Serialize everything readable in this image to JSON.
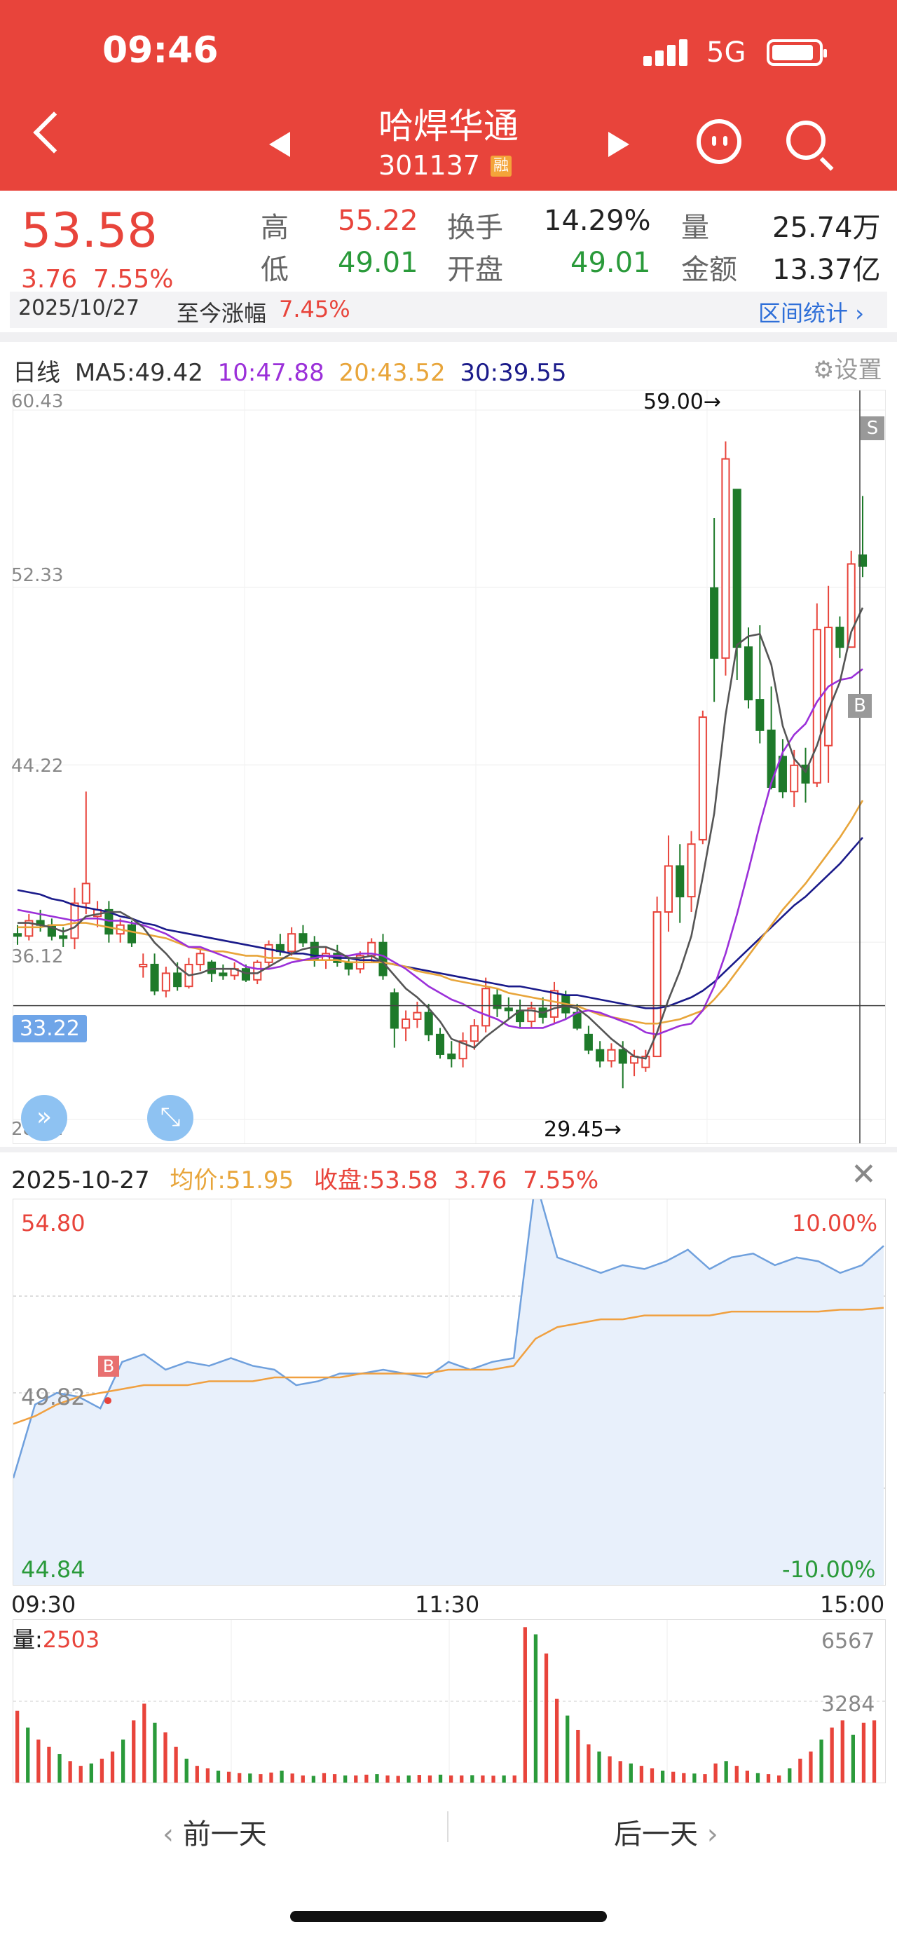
{
  "status_bar": {
    "time": "09:46",
    "network": "5G"
  },
  "header": {
    "title": "哈焊华通",
    "code": "301137",
    "badge": "融"
  },
  "quote": {
    "price": "53.58",
    "change": "3.76",
    "change_pct": "7.55%",
    "high_label": "高",
    "high": "55.22",
    "low_label": "低",
    "low": "49.01",
    "turnover_label": "换手",
    "turnover": "14.29%",
    "open_label": "开盘",
    "open": "49.01",
    "volume_label": "量",
    "volume": "25.74万",
    "amount_label": "金额",
    "amount": "13.37亿",
    "date": "2025/10/27",
    "since_label": "至今涨幅",
    "since_value": "7.45%",
    "range_stats": "区间统计"
  },
  "kline": {
    "period": "日线",
    "ma5": "MA5:49.42",
    "ma10": "10:47.88",
    "ma20": "20:43.52",
    "ma30": "30:39.55",
    "settings": "设置",
    "y_labels": [
      "60.43",
      "52.33",
      "44.22",
      "36.12",
      "28.02"
    ],
    "crosshair_price": "33.22",
    "high_mark": "59.00→",
    "low_mark": "29.45→",
    "s_mark": "S",
    "b_mark": "B",
    "colors": {
      "up": "#e8443b",
      "down": "#1e7a2a",
      "ma5": "#555555",
      "ma10": "#9b30d9",
      "ma20": "#e8a53a",
      "ma30": "#1a1a8a"
    }
  },
  "intraday": {
    "date": "2025-10-27",
    "avg": "均价:51.95",
    "close": "收盘:53.58",
    "chg": "3.76",
    "pct": "7.55%",
    "top_price": "54.80",
    "mid_price": "49.82",
    "bottom_price": "44.84",
    "top_pct": "10.00%",
    "bottom_pct": "-10.00%",
    "b_mark": "B",
    "times": [
      "09:30",
      "11:30",
      "15:00"
    ],
    "vol_label": "量:",
    "vol_value": "2503",
    "vol_max": "6567",
    "vol_mid": "3284"
  },
  "nav": {
    "prev": "前一天",
    "next": "后一天"
  },
  "chart_data": [
    {
      "type": "candlestick",
      "title": "",
      "ylim": [
        28.02,
        60.43
      ],
      "candles": [
        [
          36.5,
          36.9,
          36.0,
          36.4
        ],
        [
          36.4,
          37.4,
          36.2,
          37.1
        ],
        [
          37.1,
          37.6,
          36.6,
          36.9
        ],
        [
          36.9,
          37.2,
          36.2,
          36.4
        ],
        [
          36.4,
          36.8,
          35.9,
          36.3
        ],
        [
          36.3,
          38.6,
          35.8,
          37.9
        ],
        [
          37.9,
          43.0,
          37.4,
          38.8
        ],
        [
          37.3,
          38.0,
          36.8,
          37.6
        ],
        [
          37.6,
          38.0,
          36.1,
          36.5
        ],
        [
          36.5,
          37.2,
          36.1,
          36.9
        ],
        [
          36.9,
          37.1,
          35.9,
          36.1
        ],
        [
          35.0,
          35.6,
          34.5,
          35.1
        ],
        [
          35.1,
          35.6,
          33.7,
          33.9
        ],
        [
          33.9,
          35.0,
          33.6,
          34.7
        ],
        [
          34.7,
          35.2,
          33.9,
          34.1
        ],
        [
          34.1,
          35.4,
          34.0,
          35.1
        ],
        [
          35.1,
          35.8,
          34.8,
          35.6
        ],
        [
          35.2,
          35.3,
          34.3,
          34.7
        ],
        [
          34.7,
          35.1,
          34.4,
          34.6
        ],
        [
          34.6,
          35.2,
          34.4,
          34.9
        ],
        [
          34.9,
          35.1,
          34.3,
          34.4
        ],
        [
          34.4,
          35.3,
          34.2,
          35.2
        ],
        [
          35.2,
          36.2,
          34.9,
          36.0
        ],
        [
          36.0,
          36.5,
          35.5,
          35.7
        ],
        [
          35.7,
          36.8,
          35.5,
          36.5
        ],
        [
          36.5,
          36.9,
          35.9,
          36.1
        ],
        [
          36.1,
          36.4,
          35.0,
          35.3
        ],
        [
          35.3,
          35.9,
          34.9,
          35.6
        ],
        [
          35.6,
          36.0,
          35.0,
          35.2
        ],
        [
          35.2,
          35.4,
          34.6,
          34.9
        ],
        [
          34.9,
          35.7,
          34.7,
          35.5
        ],
        [
          35.5,
          36.3,
          35.2,
          36.1
        ],
        [
          36.1,
          36.5,
          34.4,
          34.6
        ],
        [
          33.8,
          34.0,
          31.3,
          32.2
        ],
        [
          32.2,
          33.0,
          31.6,
          32.6
        ],
        [
          32.6,
          33.4,
          32.2,
          32.9
        ],
        [
          32.9,
          33.3,
          31.6,
          31.9
        ],
        [
          31.9,
          32.2,
          30.8,
          31.0
        ],
        [
          31.0,
          31.6,
          30.4,
          30.8
        ],
        [
          30.8,
          32.0,
          30.4,
          31.6
        ],
        [
          31.6,
          32.6,
          31.2,
          32.3
        ],
        [
          32.3,
          34.5,
          32.0,
          34.0
        ],
        [
          33.7,
          34.0,
          32.7,
          33.1
        ],
        [
          33.1,
          33.6,
          32.6,
          33.0
        ],
        [
          33.0,
          33.5,
          32.2,
          32.5
        ],
        [
          32.5,
          33.4,
          32.2,
          33.1
        ],
        [
          33.1,
          33.6,
          32.4,
          32.7
        ],
        [
          32.7,
          34.3,
          32.4,
          33.9
        ],
        [
          33.7,
          33.9,
          32.6,
          32.9
        ],
        [
          32.9,
          33.3,
          32.1,
          32.2
        ],
        [
          31.9,
          32.3,
          31.0,
          31.2
        ],
        [
          31.2,
          31.6,
          30.4,
          30.7
        ],
        [
          30.7,
          31.5,
          30.4,
          31.2
        ],
        [
          31.2,
          31.6,
          29.45,
          30.6
        ],
        [
          30.6,
          31.2,
          30.0,
          30.9
        ],
        [
          30.4,
          31.2,
          30.2,
          30.9
        ],
        [
          30.9,
          38.2,
          30.9,
          37.5
        ],
        [
          37.5,
          41.0,
          36.6,
          39.6
        ],
        [
          39.6,
          40.6,
          37.0,
          38.2
        ],
        [
          38.2,
          41.2,
          37.5,
          40.6
        ],
        [
          40.8,
          46.7,
          40.6,
          46.4
        ],
        [
          52.3,
          55.5,
          47.1,
          49.1
        ],
        [
          49.1,
          59.0,
          48.3,
          58.2
        ],
        [
          56.8,
          56.8,
          48.1,
          49.6
        ],
        [
          49.6,
          50.5,
          46.8,
          47.2
        ],
        [
          47.2,
          50.6,
          45.2,
          45.8
        ],
        [
          45.8,
          47.8,
          43.1,
          43.2
        ],
        [
          44.6,
          45.4,
          42.7,
          43.0
        ],
        [
          43.0,
          44.9,
          42.3,
          44.2
        ],
        [
          44.2,
          45.0,
          42.5,
          43.4
        ],
        [
          43.4,
          51.6,
          43.2,
          50.4
        ],
        [
          45.1,
          52.4,
          43.4,
          50.5
        ],
        [
          50.5,
          51.0,
          49.1,
          49.6
        ],
        [
          49.6,
          54.0,
          49.6,
          53.4
        ],
        [
          53.8,
          56.5,
          52.8,
          53.3
        ]
      ],
      "ma5": [
        37.0,
        37.0,
        36.9,
        36.8,
        36.6,
        36.8,
        37.3,
        37.4,
        37.5,
        37.5,
        37.2,
        36.8,
        36.1,
        35.6,
        35.0,
        34.6,
        34.7,
        34.9,
        34.9,
        34.9,
        34.7,
        34.7,
        35.0,
        35.3,
        35.6,
        35.8,
        35.9,
        35.9,
        35.7,
        35.4,
        35.4,
        35.5,
        35.2,
        34.6,
        34.0,
        33.6,
        33.1,
        32.5,
        31.7,
        31.5,
        31.3,
        31.8,
        32.2,
        32.6,
        33.0,
        33.0,
        32.9,
        33.1,
        33.2,
        33.1,
        32.7,
        32.2,
        31.7,
        31.3,
        30.9,
        30.8,
        32.0,
        33.5,
        34.8,
        36.4,
        39.1,
        42.0,
        46.5,
        49.7,
        50.1,
        50.2,
        48.8,
        46.0,
        44.5,
        43.9,
        45.1,
        46.7,
        48.0,
        50.3,
        51.4
      ],
      "ma10": [
        37.6,
        37.5,
        37.4,
        37.3,
        37.2,
        37.1,
        37.2,
        37.2,
        37.1,
        37.1,
        37.0,
        36.9,
        36.7,
        36.5,
        36.2,
        35.9,
        35.9,
        35.7,
        35.5,
        35.3,
        35.0,
        34.9,
        34.9,
        35.0,
        35.2,
        35.3,
        35.4,
        35.5,
        35.5,
        35.5,
        35.6,
        35.6,
        35.5,
        35.2,
        34.9,
        34.5,
        34.1,
        33.8,
        33.5,
        33.3,
        33.0,
        32.8,
        32.6,
        32.3,
        32.2,
        32.2,
        32.2,
        32.4,
        32.6,
        32.9,
        33.0,
        32.9,
        32.7,
        32.5,
        32.3,
        32.0,
        31.9,
        32.1,
        32.3,
        32.4,
        33.0,
        34.1,
        35.6,
        37.4,
        39.4,
        41.5,
        43.4,
        44.8,
        45.6,
        46.1,
        47.1,
        47.8,
        48.1,
        48.2,
        48.6
      ],
      "ma20": [
        36.8,
        36.8,
        36.8,
        36.9,
        36.9,
        37.0,
        37.0,
        36.9,
        36.8,
        36.7,
        36.6,
        36.5,
        36.4,
        36.3,
        36.1,
        35.9,
        35.8,
        35.7,
        35.7,
        35.6,
        35.5,
        35.5,
        35.4,
        35.4,
        35.4,
        35.3,
        35.3,
        35.3,
        35.3,
        35.2,
        35.2,
        35.2,
        35.2,
        35.1,
        35.0,
        34.8,
        34.7,
        34.6,
        34.4,
        34.3,
        34.2,
        34.1,
        34.0,
        33.8,
        33.7,
        33.6,
        33.5,
        33.4,
        33.3,
        33.2,
        33.0,
        32.8,
        32.7,
        32.6,
        32.5,
        32.4,
        32.4,
        32.5,
        32.6,
        32.8,
        33.0,
        33.5,
        34.1,
        34.8,
        35.5,
        36.2,
        36.9,
        37.6,
        38.2,
        38.8,
        39.5,
        40.2,
        40.9,
        41.7,
        42.6
      ],
      "ma30": [
        38.5,
        38.4,
        38.3,
        38.1,
        38.0,
        37.8,
        37.7,
        37.6,
        37.5,
        37.3,
        37.2,
        37.0,
        36.9,
        36.7,
        36.6,
        36.5,
        36.4,
        36.3,
        36.2,
        36.1,
        36.0,
        35.9,
        35.8,
        35.7,
        35.6,
        35.6,
        35.5,
        35.5,
        35.4,
        35.4,
        35.3,
        35.3,
        35.2,
        35.1,
        35.0,
        34.9,
        34.8,
        34.7,
        34.6,
        34.5,
        34.4,
        34.3,
        34.2,
        34.1,
        34.1,
        34.0,
        33.9,
        33.8,
        33.7,
        33.7,
        33.6,
        33.5,
        33.4,
        33.3,
        33.2,
        33.1,
        33.1,
        33.2,
        33.4,
        33.6,
        33.9,
        34.3,
        34.8,
        35.3,
        35.8,
        36.3,
        36.8,
        37.3,
        37.8,
        38.2,
        38.7,
        39.2,
        39.7,
        40.3,
        40.9
      ]
    },
    {
      "type": "line",
      "title": "",
      "ylim": [
        44.84,
        54.8
      ],
      "series": [
        {
          "name": "均价",
          "values": [
            49.0,
            49.2,
            49.5,
            49.7,
            49.8,
            49.9,
            50.0,
            50.0,
            50.0,
            50.1,
            50.1,
            50.1,
            50.2,
            50.2,
            50.2,
            50.2,
            50.3,
            50.3,
            50.3,
            50.3,
            50.4,
            50.4,
            50.4,
            50.5,
            51.2,
            51.5,
            51.6,
            51.7,
            51.7,
            51.8,
            51.8,
            51.8,
            51.8,
            51.9,
            51.9,
            51.9,
            51.9,
            51.9,
            51.95,
            51.95,
            52.0
          ]
        },
        {
          "name": "price",
          "values": [
            47.6,
            49.5,
            49.8,
            49.7,
            49.4,
            50.6,
            50.8,
            50.4,
            50.6,
            50.5,
            50.7,
            50.5,
            50.4,
            50.0,
            50.1,
            50.3,
            50.3,
            50.4,
            50.3,
            50.2,
            50.6,
            50.4,
            50.6,
            50.7,
            55.3,
            53.3,
            53.1,
            52.9,
            53.1,
            53.0,
            53.2,
            53.5,
            53.0,
            53.3,
            53.4,
            53.1,
            53.3,
            53.2,
            52.9,
            53.1,
            53.6
          ]
        }
      ]
    },
    {
      "type": "bar",
      "title": "",
      "ylim": [
        0,
        6567
      ],
      "values": [
        3000,
        2300,
        1800,
        1500,
        1200,
        900,
        700,
        800,
        1000,
        1300,
        1800,
        2600,
        3300,
        2500,
        2100,
        1500,
        1000,
        700,
        600,
        500,
        450,
        400,
        380,
        350,
        420,
        500,
        380,
        300,
        280,
        400,
        350,
        300,
        300,
        330,
        350,
        300,
        280,
        300,
        320,
        300,
        330,
        300,
        300,
        310,
        300,
        290,
        300,
        300,
        6500,
        6200,
        5400,
        3500,
        2800,
        2200,
        1600,
        1300,
        1100,
        900,
        800,
        700,
        600,
        500,
        450,
        400,
        380,
        350,
        800,
        900,
        700,
        500,
        400,
        350,
        300,
        600,
        1000,
        1300,
        1800,
        2300,
        2600,
        2000,
        2500,
        2600
      ]
    }
  ]
}
